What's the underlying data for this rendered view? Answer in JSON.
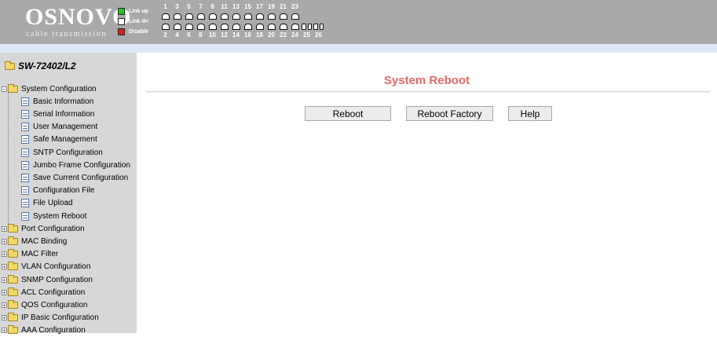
{
  "brand": {
    "name": "OSNOVO",
    "tagline": "cable transmission"
  },
  "legend": [
    {
      "label": "Link up",
      "icon": "port-link-up-icon",
      "color": "#22c422"
    },
    {
      "label": "Link dn",
      "icon": "port-link-down-icon",
      "color": "#ffffff"
    },
    {
      "label": "Disable",
      "icon": "port-disabled-icon",
      "color": "#e02020"
    }
  ],
  "ports": {
    "top_numbers": [
      "1",
      "3",
      "5",
      "7",
      "9",
      "11",
      "13",
      "15",
      "17",
      "19",
      "21",
      "23"
    ],
    "bottom_numbers": [
      "2",
      "4",
      "6",
      "8",
      "10",
      "12",
      "14",
      "16",
      "18",
      "20",
      "22",
      "24",
      "25",
      "26"
    ]
  },
  "sidebar": {
    "device": "SW-72402/L2",
    "section": "System Configuration",
    "items": [
      "Basic Information",
      "Serial Information",
      "User Management",
      "Safe Management",
      "SNTP Configuration",
      "Jumbo Frame Configuration",
      "Save Current Configuration",
      "Configuration File",
      "File Upload",
      "System Reboot"
    ],
    "folders": [
      "Port Configuration",
      "MAC Binding",
      "MAC Filter",
      "VLAN Configuration",
      "SNMP Configuration",
      "ACL Configuration",
      "QOS Configuration",
      "IP Basic Configuration",
      "AAA Configuration"
    ]
  },
  "main": {
    "title": "System Reboot",
    "buttons": {
      "reboot": "Reboot",
      "reboot_factory": "Reboot Factory",
      "help": "Help"
    }
  },
  "colors": {
    "header": "#a9a9a9",
    "sidebar": "#d7d7d7",
    "title": "#e06a6a"
  }
}
